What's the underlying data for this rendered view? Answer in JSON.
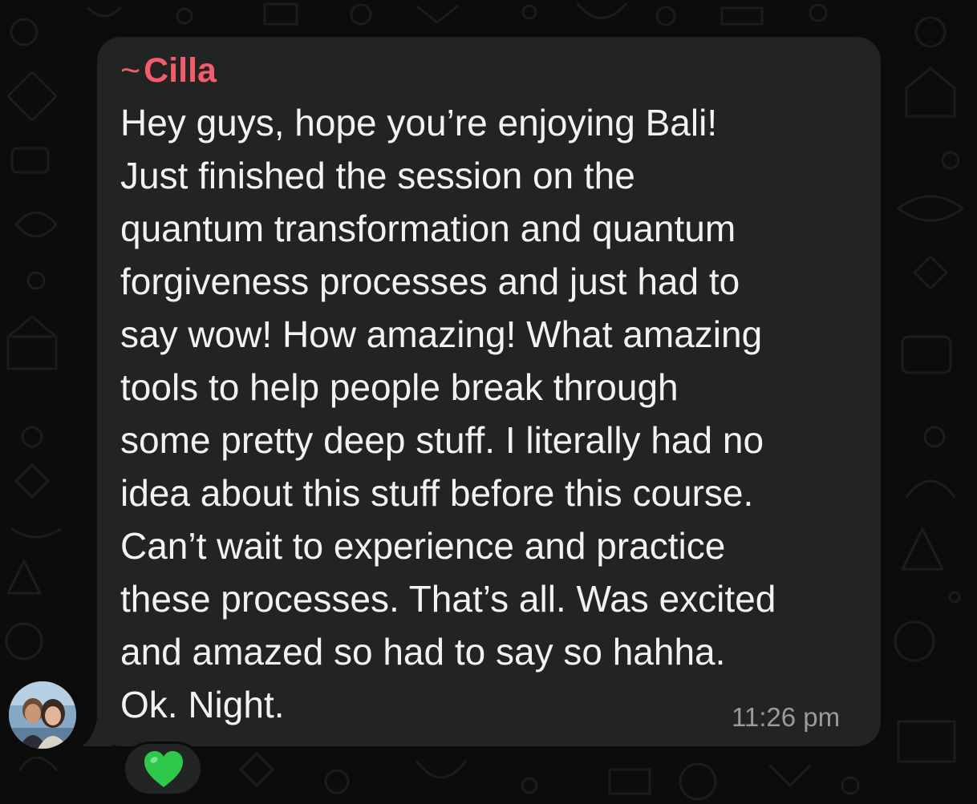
{
  "chat": {
    "message": {
      "sender": "Cilla",
      "sender_prefix": "~",
      "lines": [
        "Hey guys, hope you’re enjoying Bali!",
        "Just finished the session on the",
        "quantum transformation and quantum",
        "forgiveness processes and just had to",
        "say wow! How amazing! What amazing",
        "tools to help people break through",
        "some pretty deep stuff. I literally had no",
        "idea about this stuff before this course.",
        "Can’t wait to experience and practice",
        "these processes. That’s all. Was excited",
        "and amazed so had to say so hahha.",
        "Ok. Night."
      ],
      "time": "11:26 pm",
      "reaction_icon": "green-heart-icon"
    },
    "colors": {
      "background": "#0c0c0c",
      "bubble": "#222423",
      "sender": "#f25c6b",
      "text": "#f2f2f2",
      "timestamp": "#9a9a9a",
      "reaction_heart": "#2ec84a"
    }
  }
}
